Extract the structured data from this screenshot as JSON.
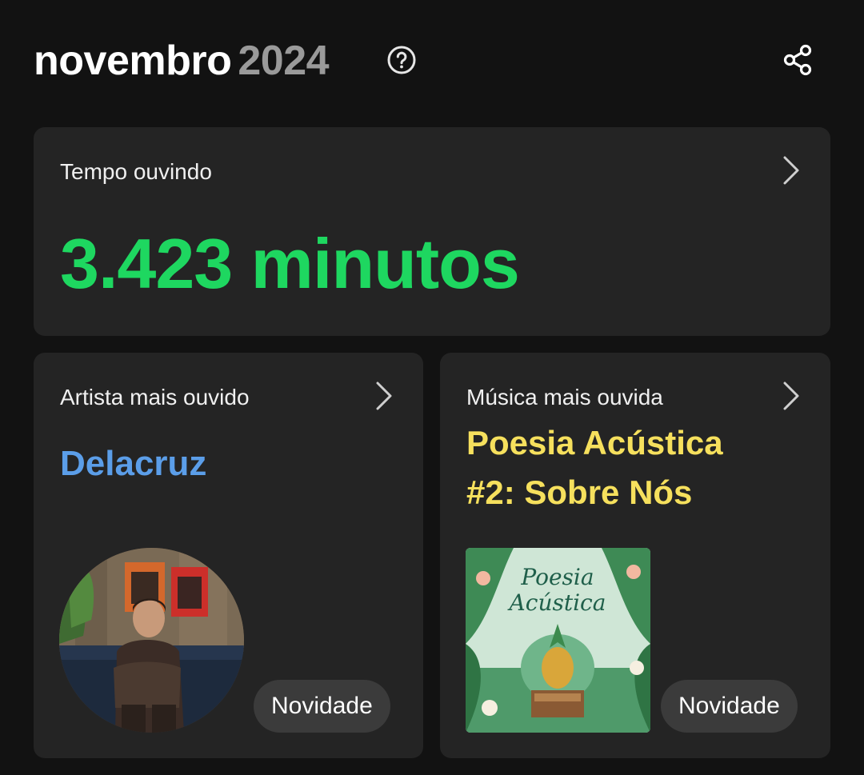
{
  "header": {
    "month": "novembro",
    "year": "2024",
    "help_icon": "help-circle-icon",
    "share_icon": "share-icon"
  },
  "listening_time": {
    "label": "Tempo ouvindo",
    "value": "3.423 minutos",
    "accent": "#1ed760",
    "chevron_icon": "chevron-right-icon"
  },
  "top_artist": {
    "label": "Artista mais ouvido",
    "name": "Delacruz",
    "badge": "Novidade",
    "accent": "#5b9ee9",
    "chevron_icon": "chevron-right-icon"
  },
  "top_song": {
    "label": "Música mais ouvida",
    "title_line1": "Poesia Acústica",
    "title_line2": "#2: Sobre Nós",
    "badge": "Novidade",
    "accent": "#f6e05d",
    "cover_text_line1": "Poesia",
    "cover_text_line2": "Acústica",
    "chevron_icon": "chevron-right-icon"
  }
}
